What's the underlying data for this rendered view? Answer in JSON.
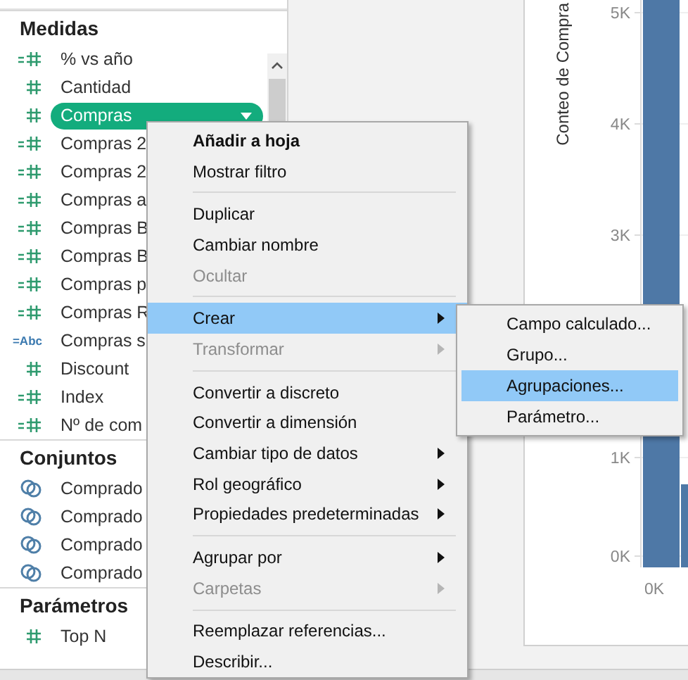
{
  "data_pane": {
    "sections": [
      {
        "title": "Medidas",
        "items": [
          {
            "label": "% vs año",
            "kind": "calc_measure",
            "selected": false
          },
          {
            "label": "Cantidad",
            "kind": "measure",
            "selected": false
          },
          {
            "label": "Compras",
            "kind": "measure",
            "selected": true
          },
          {
            "label": "Compras 2",
            "kind": "calc_measure",
            "selected": false
          },
          {
            "label": "Compras 2",
            "kind": "calc_measure",
            "selected": false
          },
          {
            "label": "Compras a",
            "kind": "calc_measure",
            "selected": false
          },
          {
            "label": "Compras B",
            "kind": "calc_measure",
            "selected": false
          },
          {
            "label": "Compras B",
            "kind": "calc_measure",
            "selected": false
          },
          {
            "label": "Compras p",
            "kind": "calc_measure",
            "selected": false
          },
          {
            "label": "Compras R",
            "kind": "calc_measure",
            "selected": false
          },
          {
            "label": "Compras s",
            "kind": "calc_string",
            "badge": "=Abc",
            "selected": false
          },
          {
            "label": "Discount",
            "kind": "measure",
            "selected": false
          },
          {
            "label": "Index",
            "kind": "calc_measure",
            "selected": false
          },
          {
            "label": "Nº de com",
            "kind": "calc_measure",
            "selected": false
          }
        ]
      },
      {
        "title": "Conjuntos",
        "items": [
          {
            "label": "Comprado",
            "kind": "set",
            "selected": false
          },
          {
            "label": "Comprado",
            "kind": "set",
            "selected": false
          },
          {
            "label": "Comprado",
            "kind": "set",
            "selected": false
          },
          {
            "label": "Comprado",
            "kind": "set",
            "selected": false
          }
        ]
      },
      {
        "title": "Parámetros",
        "items": [
          {
            "label": "Top N",
            "kind": "measure",
            "selected": false
          }
        ]
      }
    ]
  },
  "worksheet": {
    "axis_title": "Conteo de Compra",
    "y_tick_labels": [
      "5K",
      "4K",
      "3K",
      "1K",
      "0K"
    ],
    "x_tick_label": "0K"
  },
  "context_menu": {
    "items": [
      {
        "kind": "item",
        "label": "Añadir a hoja",
        "bold": true,
        "disabled": false,
        "submenu": false,
        "selected": false
      },
      {
        "kind": "item",
        "label": "Mostrar filtro",
        "bold": false,
        "disabled": false,
        "submenu": false,
        "selected": false
      },
      {
        "kind": "separator"
      },
      {
        "kind": "item",
        "label": "Duplicar",
        "bold": false,
        "disabled": false,
        "submenu": false,
        "selected": false
      },
      {
        "kind": "item",
        "label": "Cambiar nombre",
        "bold": false,
        "disabled": false,
        "submenu": false,
        "selected": false
      },
      {
        "kind": "item",
        "label": "Ocultar",
        "bold": false,
        "disabled": true,
        "submenu": false,
        "selected": false
      },
      {
        "kind": "separator"
      },
      {
        "kind": "item",
        "label": "Crear",
        "bold": false,
        "disabled": false,
        "submenu": true,
        "selected": true
      },
      {
        "kind": "item",
        "label": "Transformar",
        "bold": false,
        "disabled": true,
        "submenu": true,
        "selected": false
      },
      {
        "kind": "separator"
      },
      {
        "kind": "item",
        "label": "Convertir a discreto",
        "bold": false,
        "disabled": false,
        "submenu": false,
        "selected": false
      },
      {
        "kind": "item",
        "label": "Convertir a dimensión",
        "bold": false,
        "disabled": false,
        "submenu": false,
        "selected": false
      },
      {
        "kind": "item",
        "label": "Cambiar tipo de datos",
        "bold": false,
        "disabled": false,
        "submenu": true,
        "selected": false
      },
      {
        "kind": "item",
        "label": "Rol geográfico",
        "bold": false,
        "disabled": false,
        "submenu": true,
        "selected": false
      },
      {
        "kind": "item",
        "label": "Propiedades predeterminadas",
        "bold": false,
        "disabled": false,
        "submenu": true,
        "selected": false
      },
      {
        "kind": "separator"
      },
      {
        "kind": "item",
        "label": "Agrupar por",
        "bold": false,
        "disabled": false,
        "submenu": true,
        "selected": false
      },
      {
        "kind": "item",
        "label": "Carpetas",
        "bold": false,
        "disabled": true,
        "submenu": true,
        "selected": false
      },
      {
        "kind": "separator"
      },
      {
        "kind": "item",
        "label": "Reemplazar referencias...",
        "bold": false,
        "disabled": false,
        "submenu": false,
        "selected": false
      },
      {
        "kind": "item",
        "label": "Describir...",
        "bold": false,
        "disabled": false,
        "submenu": false,
        "selected": false
      }
    ]
  },
  "submenu": {
    "items": [
      {
        "kind": "item",
        "label": "Campo calculado...",
        "selected": false
      },
      {
        "kind": "item",
        "label": "Grupo...",
        "selected": false
      },
      {
        "kind": "item",
        "label": "Agrupaciones...",
        "selected": true
      },
      {
        "kind": "item",
        "label": "Parámetro...",
        "selected": false
      }
    ]
  }
}
